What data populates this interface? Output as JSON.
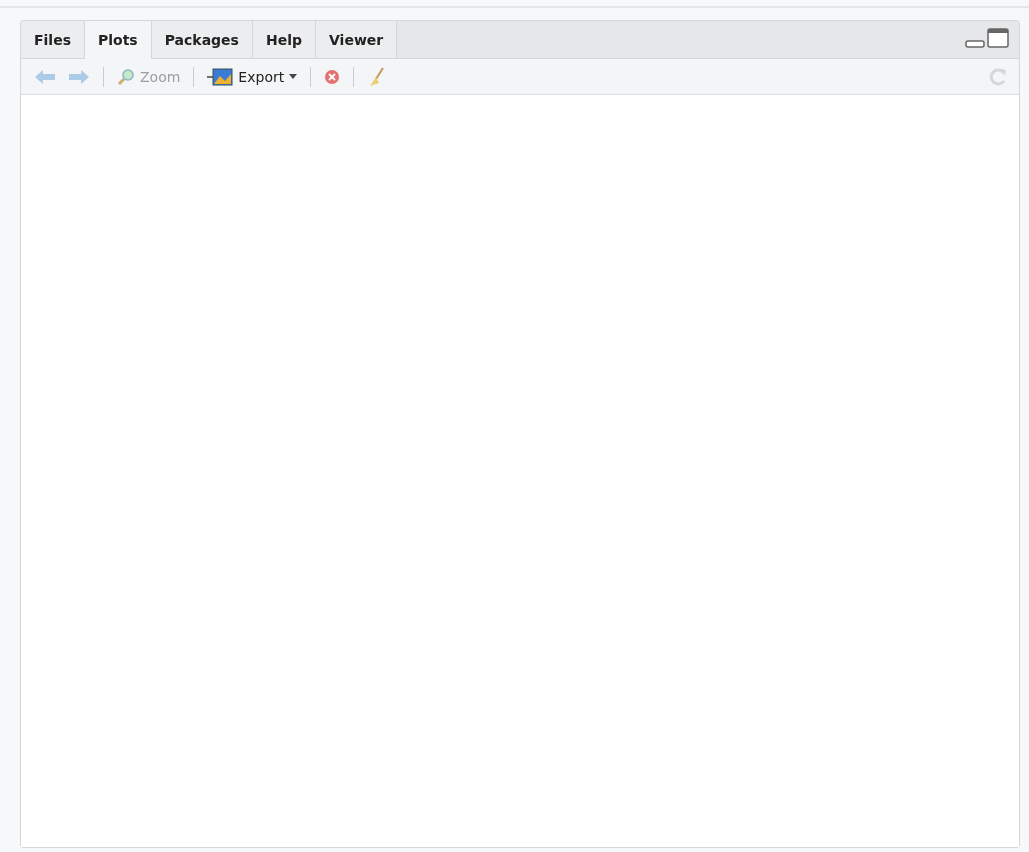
{
  "tabs": [
    {
      "label": "Files",
      "selected": false
    },
    {
      "label": "Plots",
      "selected": true
    },
    {
      "label": "Packages",
      "selected": false
    },
    {
      "label": "Help",
      "selected": false
    },
    {
      "label": "Viewer",
      "selected": false
    }
  ],
  "toolbar": [
    {
      "kind": "back",
      "disabled": true
    },
    {
      "kind": "forward",
      "disabled": true
    },
    {
      "kind": "separator"
    },
    {
      "kind": "zoom",
      "label": "Zoom",
      "disabled": true
    },
    {
      "kind": "separator"
    },
    {
      "kind": "export",
      "label": "Export",
      "disabled": false
    },
    {
      "kind": "separator"
    },
    {
      "kind": "remove",
      "disabled": true
    },
    {
      "kind": "separator"
    },
    {
      "kind": "clear",
      "disabled": true
    }
  ],
  "refresh": {
    "disabled": true
  }
}
